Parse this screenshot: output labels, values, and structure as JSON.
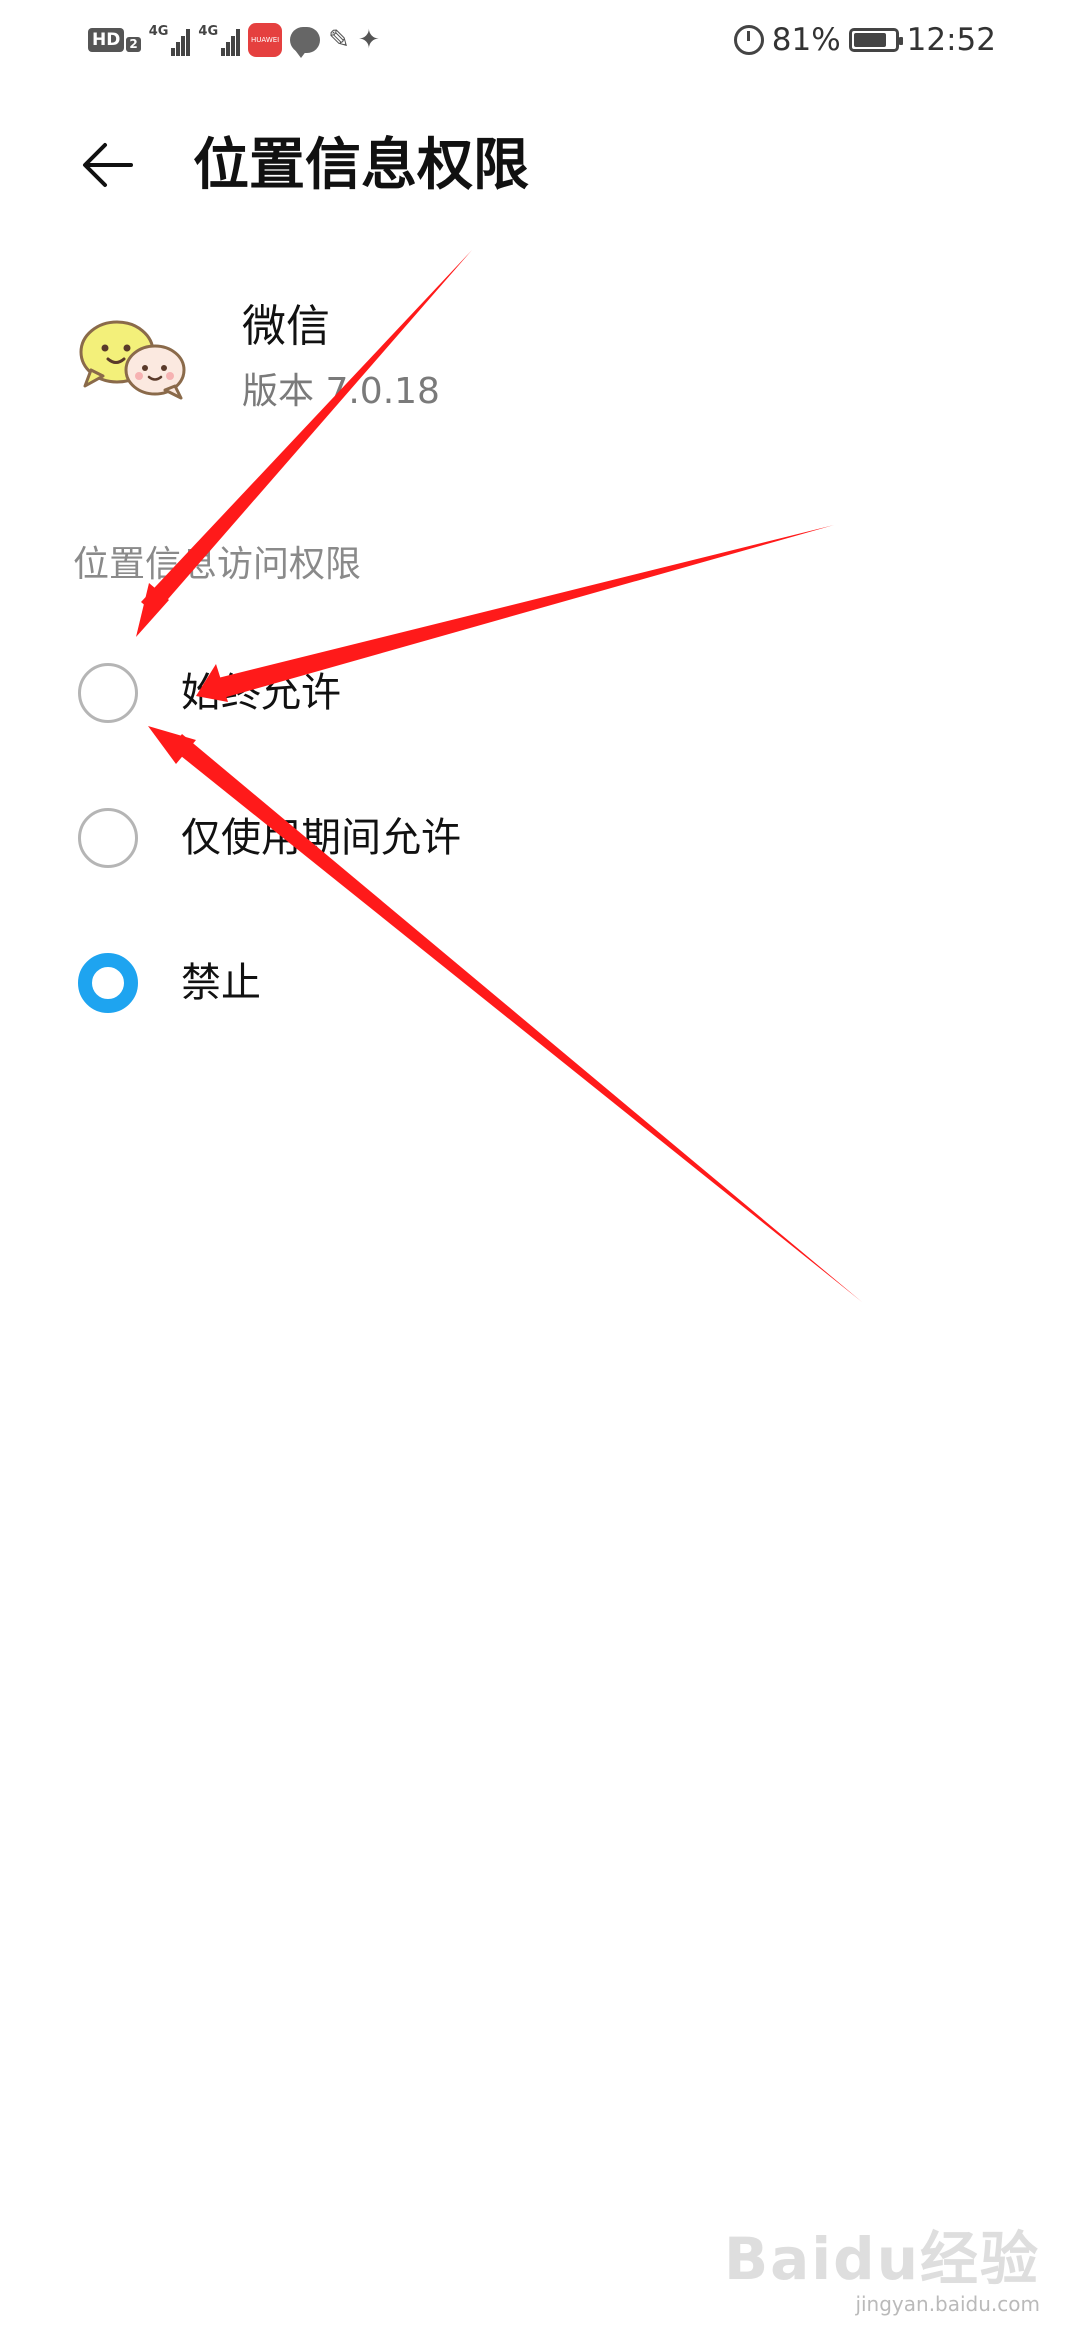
{
  "status_bar": {
    "hd_label": "HD",
    "hd_sub": "2",
    "network_1": "4G",
    "network_2": "4G",
    "app_badge_text": "HUAWEI",
    "battery_percent": "81%",
    "battery_level": 0.81,
    "time": "12:52",
    "icons": [
      "hd-icon",
      "signal-icon",
      "signal-icon",
      "huawei-app-icon",
      "message-icon",
      "notification-icon",
      "alipay-icon",
      "alarm-icon",
      "battery-icon"
    ]
  },
  "header": {
    "title": "位置信息权限",
    "back_icon": "arrow-left-icon"
  },
  "app": {
    "name": "微信",
    "version": "版本 7.0.18",
    "icon": "wechat-icon"
  },
  "permission": {
    "section_title": "位置信息访问权限",
    "options": [
      {
        "label": "始终允许",
        "selected": false
      },
      {
        "label": "仅使用期间允许",
        "selected": false
      },
      {
        "label": "禁止",
        "selected": true
      }
    ],
    "accent_color": "#1ea4f0"
  },
  "annotation": {
    "arrow_color": "#ff1a1a"
  },
  "watermark": {
    "main": "Baidu经验",
    "sub": "jingyan.baidu.com"
  }
}
